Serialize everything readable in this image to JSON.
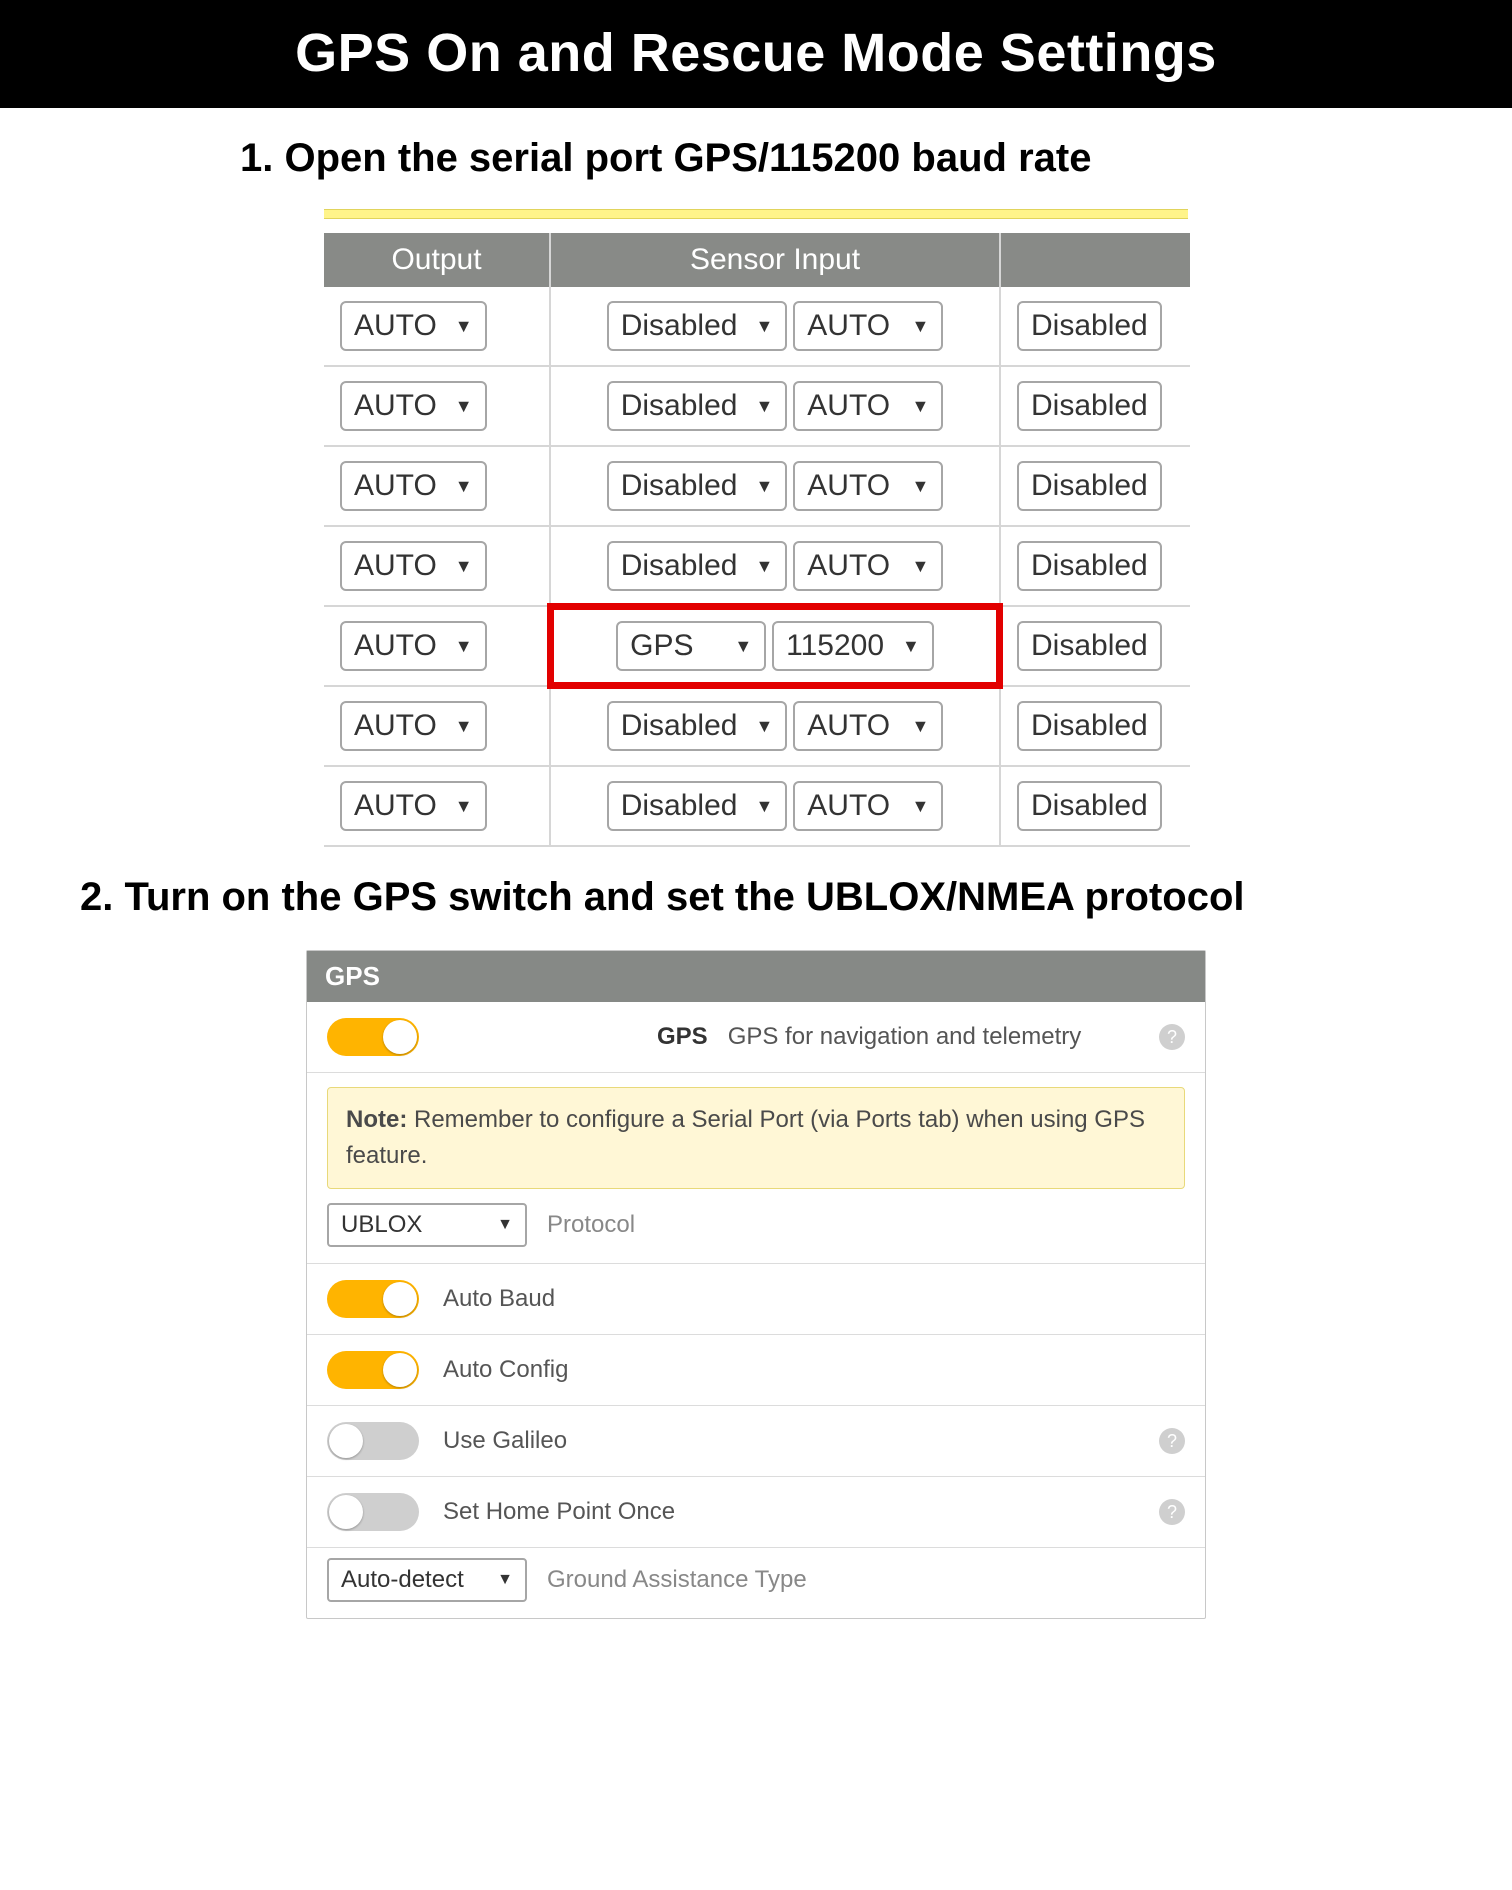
{
  "title": "GPS On and Rescue Mode Settings",
  "step1_heading": "1. Open the serial port GPS/115200 baud rate",
  "step2_heading": "2. Turn on the GPS switch and set the UBLOX/NMEA protocol",
  "ports_table": {
    "headers": {
      "output": "Output",
      "sensor": "Sensor Input",
      "extra": ""
    },
    "rows": [
      {
        "output": "AUTO",
        "sensor1": "Disabled",
        "sensor2": "AUTO",
        "extra": "Disabled",
        "highlight": false
      },
      {
        "output": "AUTO",
        "sensor1": "Disabled",
        "sensor2": "AUTO",
        "extra": "Disabled",
        "highlight": false
      },
      {
        "output": "AUTO",
        "sensor1": "Disabled",
        "sensor2": "AUTO",
        "extra": "Disabled",
        "highlight": false
      },
      {
        "output": "AUTO",
        "sensor1": "Disabled",
        "sensor2": "AUTO",
        "extra": "Disabled",
        "highlight": false
      },
      {
        "output": "AUTO",
        "sensor1": "GPS",
        "sensor2": "115200",
        "extra": "Disabled",
        "highlight": true
      },
      {
        "output": "AUTO",
        "sensor1": "Disabled",
        "sensor2": "AUTO",
        "extra": "Disabled",
        "highlight": false
      },
      {
        "output": "AUTO",
        "sensor1": "Disabled",
        "sensor2": "AUTO",
        "extra": "Disabled",
        "highlight": false
      }
    ]
  },
  "gps_panel": {
    "header": "GPS",
    "main_label_bold": "GPS",
    "main_label_desc": "GPS for navigation and telemetry",
    "note_bold": "Note:",
    "note_text": " Remember to configure a Serial Port (via Ports tab) when using GPS feature.",
    "protocol_value": "UBLOX",
    "protocol_label": "Protocol",
    "toggles": {
      "auto_baud": "Auto Baud",
      "auto_config": "Auto Config",
      "use_galileo": "Use Galileo",
      "set_home": "Set Home Point Once"
    },
    "ground_value": "Auto-detect",
    "ground_label": "Ground Assistance Type"
  }
}
